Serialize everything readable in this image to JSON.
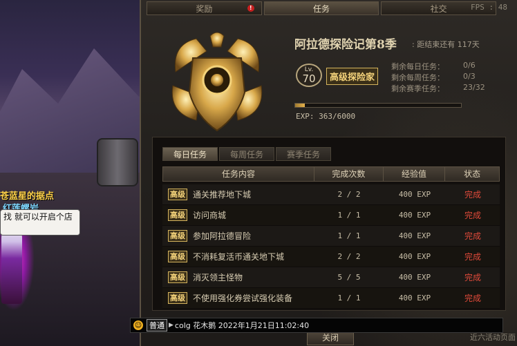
{
  "scene": {
    "npc_name": "苍蓝星的据点",
    "npc_sub": "红莲螺岩",
    "bubble": "找 就可以开启个店"
  },
  "tabs": [
    {
      "label": "奖励",
      "active": false,
      "alert": "!"
    },
    {
      "label": "任务",
      "active": true
    },
    {
      "label": "社交",
      "active": false
    }
  ],
  "fps": "FPS : 48",
  "season": {
    "title": "阿拉德探险记第8季",
    "countdown": ": 距结束还有 117天",
    "level_prefix": "Lv.",
    "level": "70",
    "rank": "高级探险家",
    "stats": [
      {
        "label": "剩余每日任务：",
        "value": "0/6"
      },
      {
        "label": "剩余每周任务：",
        "value": "0/3"
      },
      {
        "label": "剩余赛季任务：",
        "value": "23/32"
      }
    ],
    "exp_label": "EXP: 363/6000",
    "exp_fraction": 0.06
  },
  "quest_tabs": [
    {
      "label": "每日任务",
      "active": true
    },
    {
      "label": "每周任务",
      "active": false
    },
    {
      "label": "赛季任务",
      "active": false
    }
  ],
  "table": {
    "headers": [
      "任务内容",
      "完成次数",
      "经验值",
      "状态"
    ],
    "rows": [
      {
        "tag": "高级",
        "name": "通关推荐地下城",
        "count": "2 / 2",
        "exp": "400 EXP",
        "status": "完成"
      },
      {
        "tag": "高级",
        "name": "访问商城",
        "count": "1 / 1",
        "exp": "400 EXP",
        "status": "完成"
      },
      {
        "tag": "高级",
        "name": "参加阿拉德冒险",
        "count": "1 / 1",
        "exp": "400 EXP",
        "status": "完成"
      },
      {
        "tag": "高级",
        "name": "不消耗复活币通关地下城",
        "count": "2 / 2",
        "exp": "400 EXP",
        "status": "完成"
      },
      {
        "tag": "高级",
        "name": "消灭领主怪物",
        "count": "5 / 5",
        "exp": "400 EXP",
        "status": "完成"
      },
      {
        "tag": "高级",
        "name": "不使用强化券尝试强化装备",
        "count": "1 / 1",
        "exp": "400 EXP",
        "status": "完成"
      }
    ]
  },
  "footer": {
    "close_label": "关闭",
    "right_link": "近六活动页面"
  },
  "chat": {
    "channel": "普通",
    "text": "colg 花木鹅 2022年1月21日11:02:40"
  },
  "colors": {
    "accent_gold": "#d6b55e",
    "status_red": "#e04a3a",
    "exp_bar": "#e6b24c"
  }
}
